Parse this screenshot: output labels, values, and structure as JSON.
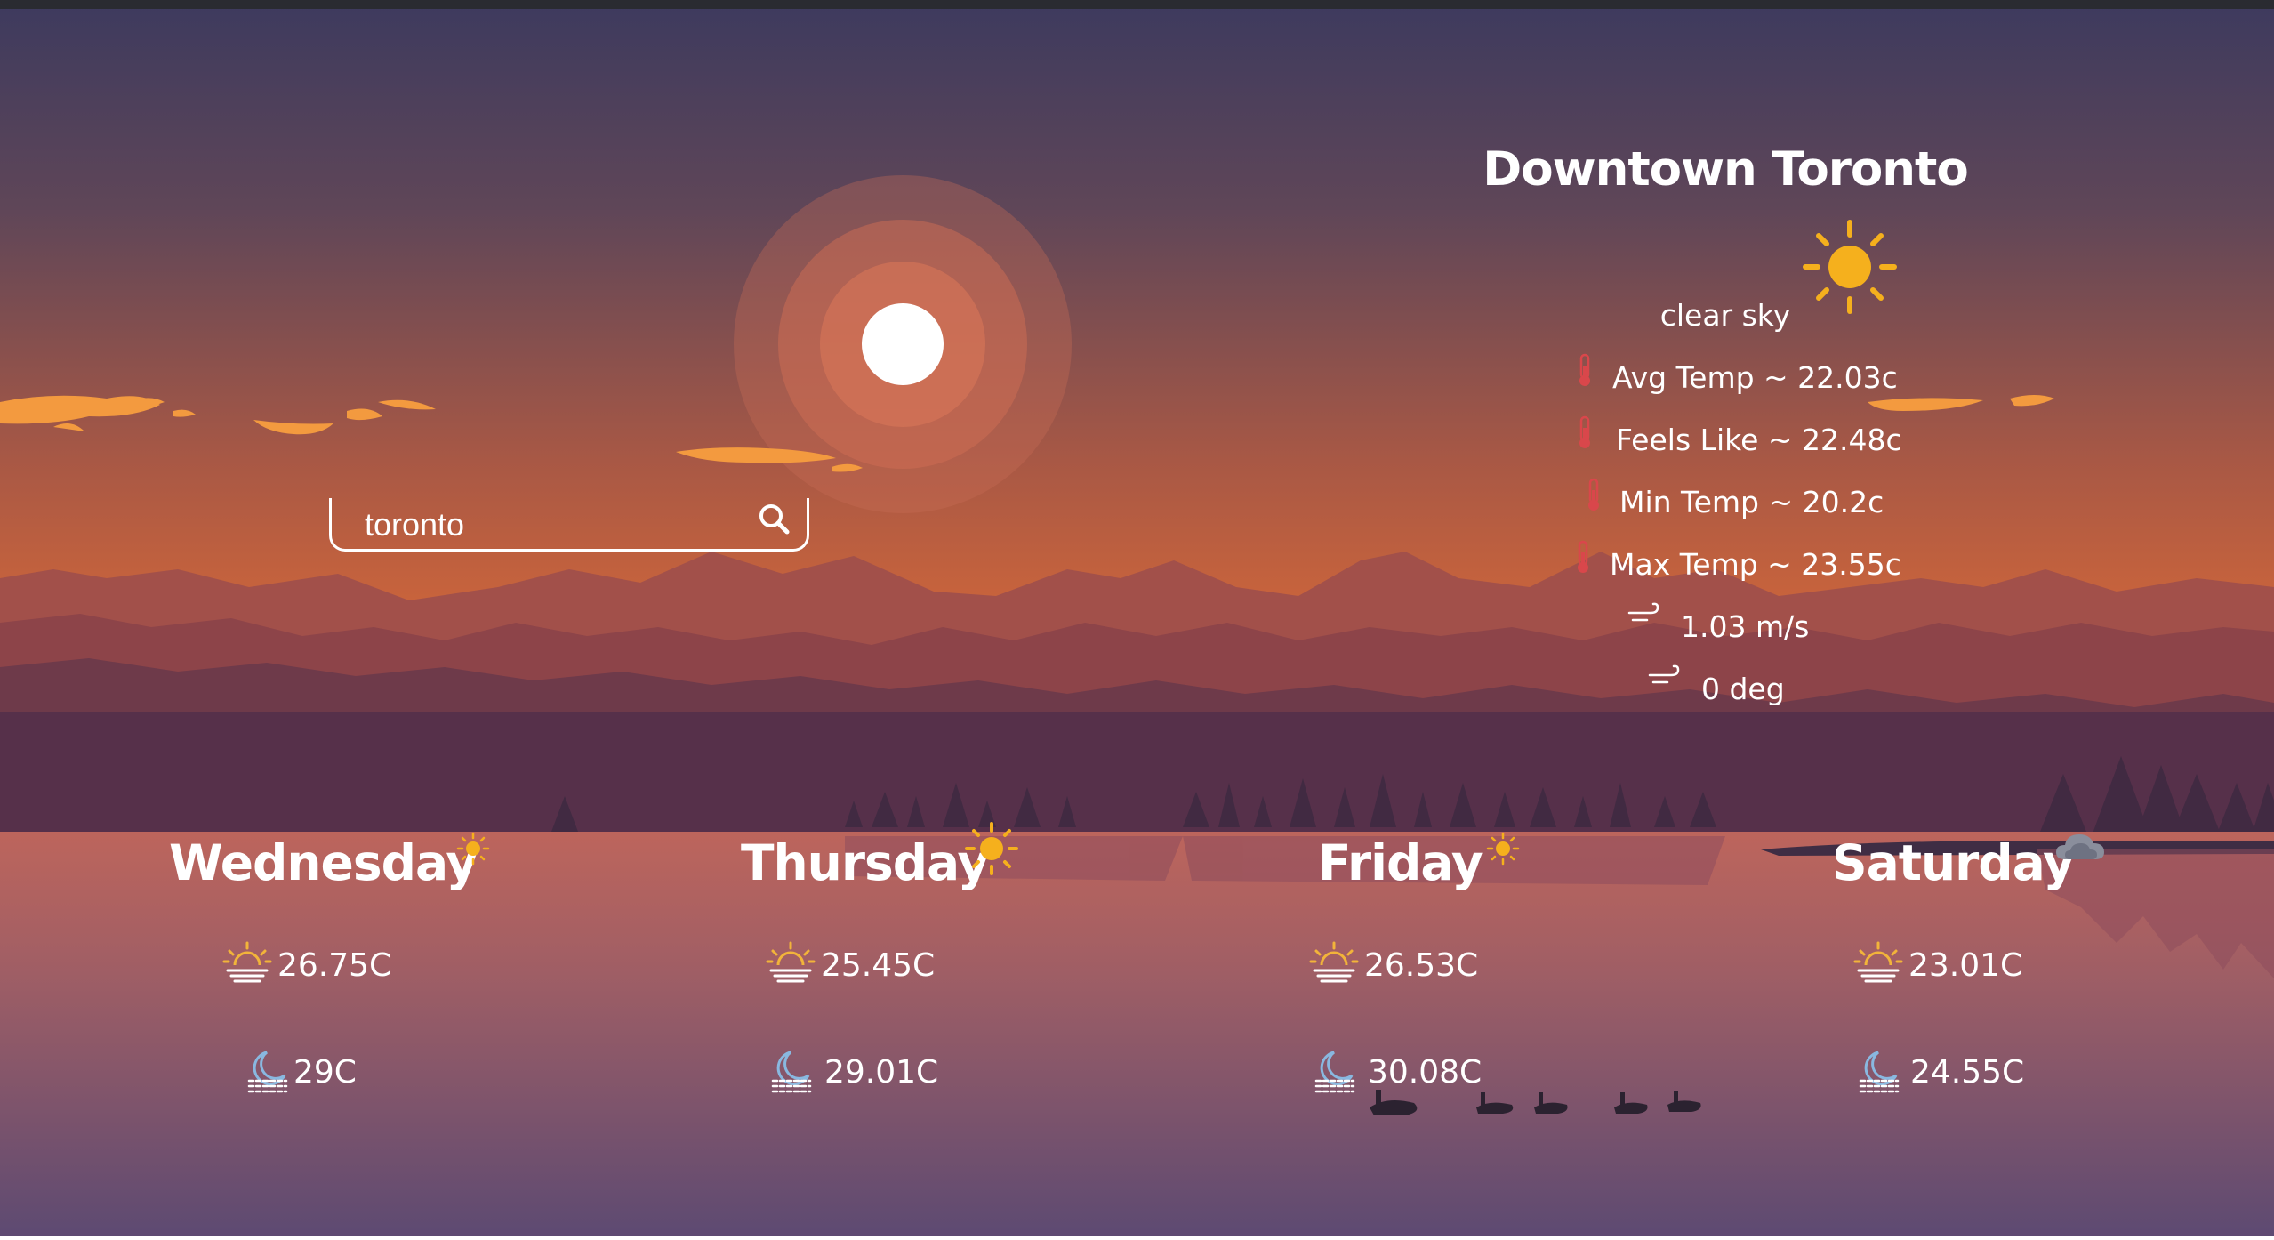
{
  "search": {
    "value": "toronto"
  },
  "current": {
    "city": "Downtown Toronto",
    "icon": "sun-icon",
    "description": "clear sky",
    "stats": [
      {
        "icon": "thermometer-icon",
        "label": "Avg Temp ~ 22.03c"
      },
      {
        "icon": "thermometer-icon",
        "label": "Feels Like ~ 22.48c"
      },
      {
        "icon": "thermometer-icon",
        "label": "Min Temp ~ 20.2c"
      },
      {
        "icon": "thermometer-icon",
        "label": "Max Temp ~ 23.55c"
      },
      {
        "icon": "wind-icon",
        "label": "1.03 m/s"
      },
      {
        "icon": "wind-icon",
        "label": "0 deg"
      }
    ]
  },
  "forecast": [
    {
      "day": "Wednesday",
      "icon": "small-sun-icon",
      "day_temp": "26.75C",
      "night_temp": "29C"
    },
    {
      "day": "Thursday",
      "icon": "sun-icon",
      "day_temp": "25.45C",
      "night_temp": "29.01C"
    },
    {
      "day": "Friday",
      "icon": "small-sun-icon",
      "day_temp": "26.53C",
      "night_temp": "30.08C"
    },
    {
      "day": "Saturday",
      "icon": "cloud-icon",
      "day_temp": "23.01C",
      "night_temp": "24.55C"
    }
  ],
  "colors": {
    "sky_top": "#3f3a5e",
    "sky_bottom": "#e9733a",
    "sun_icon": "#f5b01d",
    "sunrise_icon": "#f2b43a",
    "moon_icon": "#89b8e0",
    "thermometer": "#d9474b",
    "water_top": "#b9625c",
    "water_bottom": "#5d4a72"
  }
}
